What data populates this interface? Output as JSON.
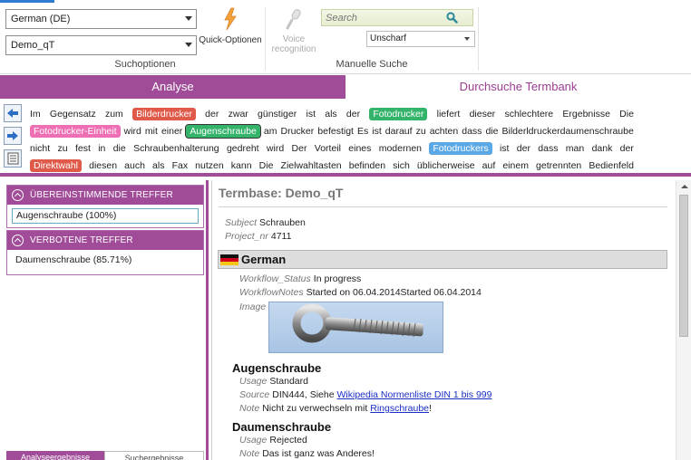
{
  "ribbon": {
    "language_select": "German (DE)",
    "termbase_select": "Demo_qT",
    "search_options_label": "Suchoptionen",
    "quick_options_label": "Quick-Optionen",
    "voice_label_line1": "Voice",
    "voice_label_line2": "recognition",
    "search_placeholder": "Search",
    "fuzzy_select": "Unscharf",
    "manual_search_label": "Manuelle Suche"
  },
  "tabs": {
    "analysis": "Analyse",
    "termbank_search": "Durchsuche Termbank"
  },
  "analysis_text": {
    "lines": [
      [
        {
          "t": "Im"
        },
        {
          "t": "Gegensatz"
        },
        {
          "t": "zum"
        },
        {
          "t": "Bilderdrucker",
          "hl": "red"
        },
        {
          "t": "der"
        },
        {
          "t": "zwar"
        },
        {
          "t": "günstiger"
        },
        {
          "t": "ist"
        },
        {
          "t": "als"
        },
        {
          "t": "der"
        },
        {
          "t": "Fotodrucker",
          "hl": "green"
        },
        {
          "t": "liefert"
        },
        {
          "t": "dieser"
        },
        {
          "t": "schlechtere"
        },
        {
          "t": "Ergebnisse"
        },
        {
          "t": "Die"
        }
      ],
      [
        {
          "t": "Fotodrucker-Einheit",
          "hl": "pink"
        },
        {
          "t": "wird"
        },
        {
          "t": "mit"
        },
        {
          "t": "einer"
        },
        {
          "t": "Augenschraube",
          "hl": "green-box"
        },
        {
          "t": "am"
        },
        {
          "t": "Drucker"
        },
        {
          "t": "befestigt"
        },
        {
          "t": "Es"
        },
        {
          "t": "ist"
        },
        {
          "t": "darauf"
        },
        {
          "t": "zu"
        },
        {
          "t": "achten"
        },
        {
          "t": "dass"
        },
        {
          "t": "die"
        },
        {
          "t": "Bilderldruckerdaumenschraube"
        }
      ],
      [
        {
          "t": "nicht"
        },
        {
          "t": "zu"
        },
        {
          "t": "fest"
        },
        {
          "t": "in"
        },
        {
          "t": "die"
        },
        {
          "t": "Schraubenhalterung"
        },
        {
          "t": "gedreht"
        },
        {
          "t": "wird"
        },
        {
          "t": "Der"
        },
        {
          "t": "Vorteil"
        },
        {
          "t": "eines"
        },
        {
          "t": "modernen"
        },
        {
          "t": "Fotodruckers",
          "hl": "blue"
        },
        {
          "t": "ist"
        },
        {
          "t": "der"
        },
        {
          "t": "dass"
        },
        {
          "t": "man"
        },
        {
          "t": "dank"
        },
        {
          "t": "der"
        }
      ],
      [
        {
          "t": "Direktwahl",
          "hl": "red"
        },
        {
          "t": "diesen"
        },
        {
          "t": "auch"
        },
        {
          "t": "als"
        },
        {
          "t": "Fax"
        },
        {
          "t": "nutzen"
        },
        {
          "t": "kann"
        },
        {
          "t": "Die"
        },
        {
          "t": "Zielwahltasten"
        },
        {
          "t": "befinden"
        },
        {
          "t": "sich"
        },
        {
          "t": "üblicherweise"
        },
        {
          "t": "auf"
        },
        {
          "t": "einem"
        },
        {
          "t": "getrennten"
        },
        {
          "t": "Bedienfeld"
        }
      ]
    ]
  },
  "left_pane": {
    "matching_header": "ÜBEREINSTIMMENDE TREFFER",
    "matching_items": [
      "Augenschraube (100%)"
    ],
    "forbidden_header": "VERBOTENE TREFFER",
    "forbidden_items": [
      "Daumenschraube (85.71%)"
    ],
    "bottom_tab_1": "Analyseergebnisse",
    "bottom_tab_2": "Suchergebnisse"
  },
  "termbase": {
    "title": "Termbase: Demo_qT",
    "subject_label": "Subject",
    "subject_value": "Schrauben",
    "project_label": "Project_nr",
    "project_value": "4711",
    "language": "German",
    "workflow_status_label": "Workflow_Status",
    "workflow_status_value": "In progress",
    "workflow_notes_label": "WorkflowNotes",
    "workflow_notes_value": "Started on 06.04.2014Started 06.04.2014",
    "image_label": "Image",
    "terms": [
      {
        "name": "Augenschraube",
        "usage_label": "Usage",
        "usage_value": "Standard",
        "source_label": "Source",
        "source_prefix": "DIN444, Siehe",
        "source_link": "Wikipedia Normenliste DIN 1 bis 999",
        "note_label": "Note",
        "note_prefix": "Nicht zu verwechseln mit",
        "note_link": "Ringschraube",
        "note_suffix": "!"
      },
      {
        "name": "Daumenschraube",
        "usage_label": "Usage",
        "usage_value": "Rejected",
        "note_label": "Note",
        "note_value": "Das ist ganz was Anderes!"
      }
    ]
  },
  "colors": {
    "accent_purple": "#a04c98",
    "highlight_red": "#e05a49",
    "highlight_green": "#34b36a",
    "highlight_pink": "#ee6fb3",
    "highlight_blue": "#5aa9e6",
    "link_blue": "#1b2fc6"
  },
  "icons": [
    "lightning-icon",
    "microphone-icon",
    "search-icon",
    "arrow-left-icon",
    "arrow-right-icon",
    "notes-icon",
    "collapse-chevron-icon",
    "german-flag-icon",
    "scroll-up-icon"
  ]
}
